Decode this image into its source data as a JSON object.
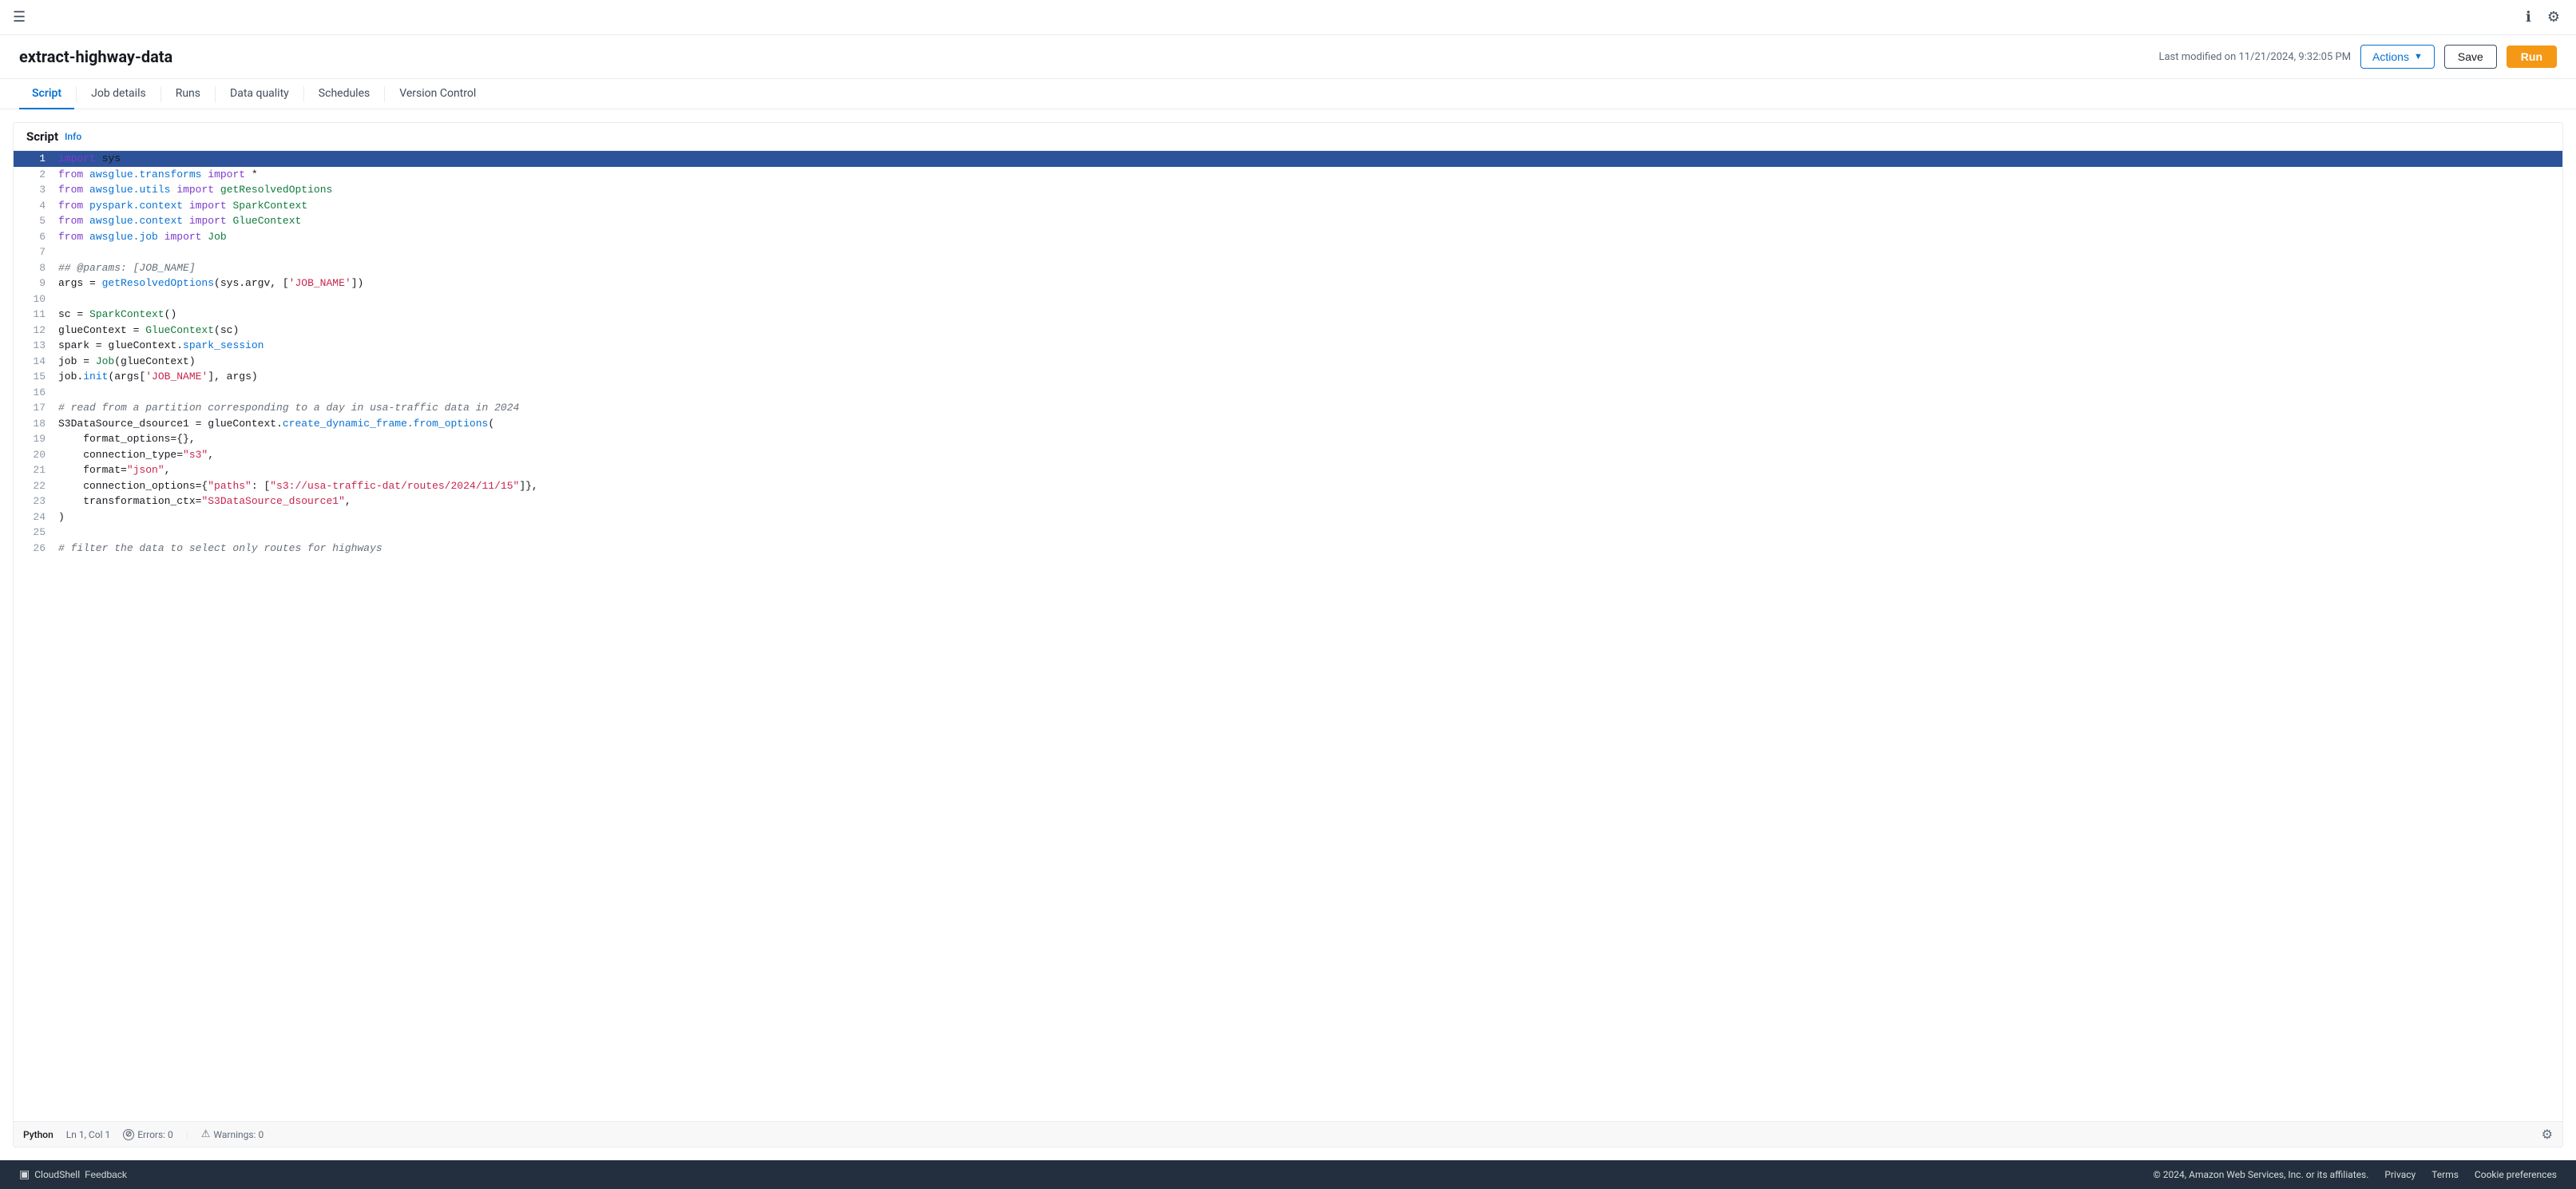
{
  "topbar": {
    "hamburger": "☰",
    "info_icon": "ℹ",
    "settings_icon": "⚙"
  },
  "job": {
    "title": "extract-highway-data",
    "last_modified": "Last modified on 11/21/2024, 9:32:05 PM",
    "actions_label": "Actions",
    "save_label": "Save",
    "run_label": "Run"
  },
  "tabs": [
    {
      "id": "script",
      "label": "Script",
      "active": true
    },
    {
      "id": "job-details",
      "label": "Job details",
      "active": false
    },
    {
      "id": "runs",
      "label": "Runs",
      "active": false
    },
    {
      "id": "data-quality",
      "label": "Data quality",
      "active": false
    },
    {
      "id": "schedules",
      "label": "Schedules",
      "active": false
    },
    {
      "id": "version-control",
      "label": "Version Control",
      "active": false
    }
  ],
  "script_section": {
    "title": "Script",
    "info_label": "Info"
  },
  "status_bar": {
    "language": "Python",
    "cursor": "Ln 1, Col 1",
    "errors_label": "Errors: 0",
    "warnings_label": "Warnings: 0"
  },
  "footer": {
    "cloudshell_label": "CloudShell",
    "feedback_label": "Feedback",
    "copyright": "© 2024, Amazon Web Services, Inc. or its affiliates.",
    "privacy_label": "Privacy",
    "terms_label": "Terms",
    "cookie_label": "Cookie preferences"
  }
}
